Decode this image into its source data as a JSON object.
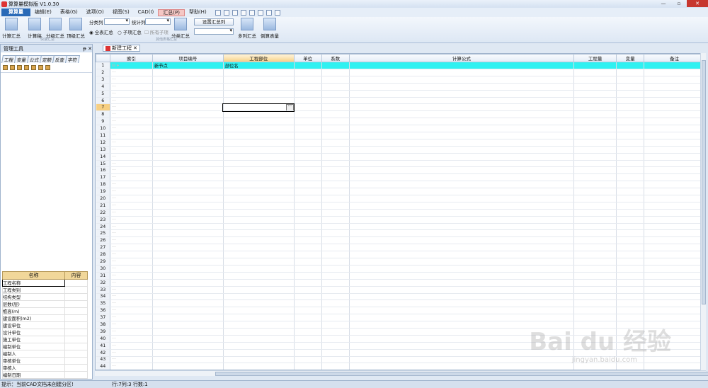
{
  "window": {
    "title": "算算量模拟版 V1.0.30",
    "controls": [
      "—",
      "▫",
      "✕"
    ]
  },
  "menu": {
    "app": "算算量",
    "items": [
      "编辑(E)",
      "表格(G)",
      "选项(O)",
      "视图(S)",
      "CAD(I)",
      "汇总(P)",
      "帮助(H)"
    ],
    "active": "汇总(P)"
  },
  "ribbon": {
    "btn_calc_sum": "计算汇总",
    "btn_calc_draft": "计算稿",
    "btn_sub_sum": "分级汇总",
    "btn_top_sum": "顶级汇总",
    "group1": "快速汇总",
    "lbl_category": "分类列",
    "lbl_stat": "统计列",
    "radio_all": "全表汇总",
    "radio_sub": "子项汇总",
    "chk_all_children": "所有子项",
    "btn_split": "分类汇总",
    "btn_setting": "设置汇总列",
    "group2": "其他表格汇总",
    "btn_multi": "多列汇总",
    "btn_inverse": "倒算表量"
  },
  "left_panel": {
    "title": "管理工具",
    "pin": "ᵽ ✕",
    "tabs": [
      "工程",
      "变量",
      "公式",
      "定额",
      "反查",
      "字符"
    ],
    "props_header": [
      "名称",
      "内容"
    ],
    "props": [
      "工程名称",
      "工程类别",
      "结构类型",
      "层数(层)",
      "檐高(m)",
      "建设面积(m2)",
      "建设单位",
      "设计单位",
      "施工单位",
      "编制单位",
      "编制人",
      "审核单位",
      "审核人",
      "编制日期"
    ]
  },
  "doc_tab": {
    "label": "新建工程",
    "close": "✕"
  },
  "grid": {
    "columns": [
      "",
      "索引",
      "项目编号",
      "工程部位",
      "单位",
      "系数",
      "计算公式",
      "工程量",
      "变量",
      "备注"
    ],
    "row1": {
      "node": "新节点",
      "part": "部位名"
    },
    "row_count": 44,
    "current_row": 7
  },
  "status": {
    "hint": "提示：当前CAD文档未创建分区!",
    "pos": "行:7列:3  行数:1"
  },
  "watermark": {
    "brand": "Bai du 经验",
    "url": "jingyan.baidu.com"
  }
}
